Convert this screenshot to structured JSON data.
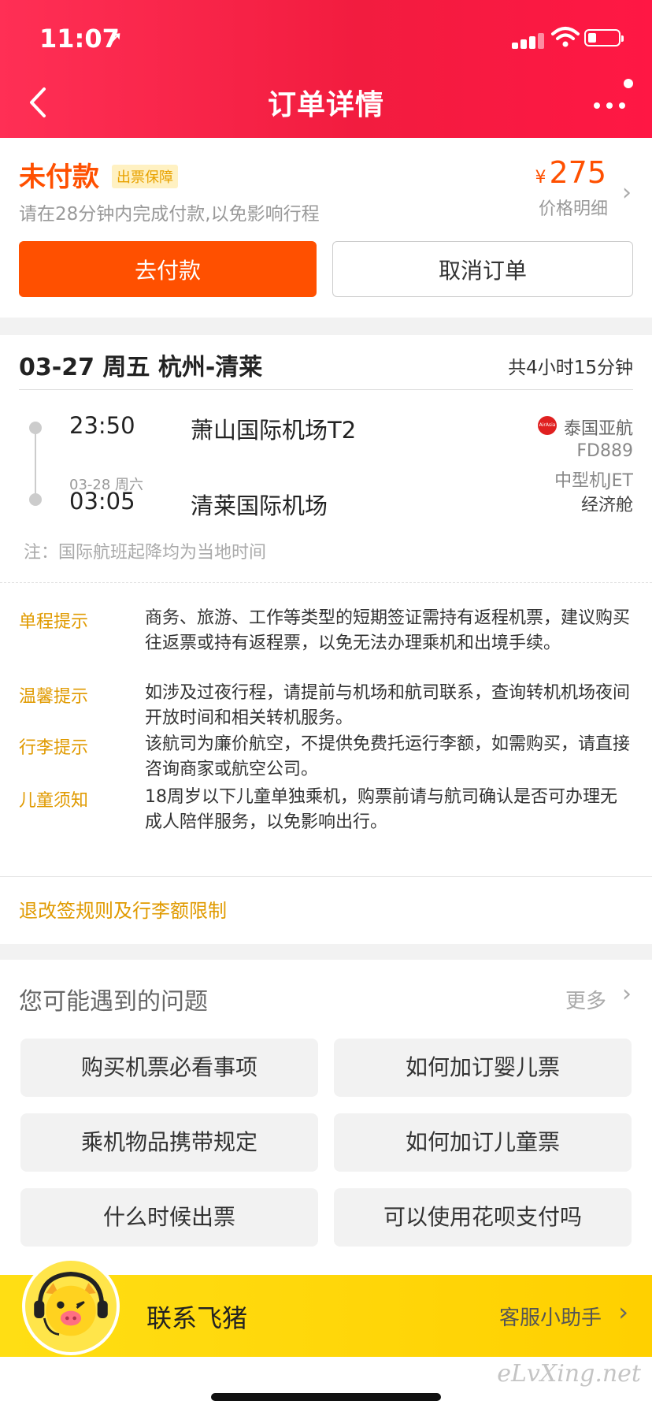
{
  "status_bar": {
    "time": "11:07",
    "location_glyph": "➚"
  },
  "header": {
    "title": "订单详情",
    "back_icon": "chevron-left-icon",
    "more_icon": "more-dots-icon"
  },
  "order_status": {
    "title": "未付款",
    "badge": "出票保障",
    "hint": "请在28分钟内完成付款,以免影响行程",
    "currency": "¥",
    "price": "275",
    "price_detail_label": "价格明细",
    "pay_label": "去付款",
    "cancel_label": "取消订单"
  },
  "flight": {
    "route_title": "03-27 周五 杭州-清莱",
    "duration": "共4小时15分钟",
    "departure_time": "23:50",
    "departure_airport": "萧山国际机场T2",
    "arrival_date": "03-28 周六",
    "arrival_time": "03:05",
    "arrival_airport": "清莱国际机场",
    "airline_logo_text": "AirAsia",
    "airline": "泰国亚航",
    "flight_no": "FD889",
    "aircraft": "中型机JET",
    "cabin": "经济舱",
    "note": "注：国际航班起降均为当地时间"
  },
  "tips": [
    {
      "label": "单程提示",
      "text": "商务、旅游、工作等类型的短期签证需持有返程机票，建议购买往返票或持有返程票，以免无法办理乘机和出境手续。"
    },
    {
      "label": "温馨提示",
      "text": "如涉及过夜行程，请提前与机场和航司联系，查询转机机场夜间开放时间和相关转机服务。"
    },
    {
      "label": "行李提示",
      "text": "该航司为廉价航空，不提供免费托运行李额，如需购买，请直接咨询商家或航空公司。"
    },
    {
      "label": "儿童须知",
      "text": "18周岁以下儿童单独乘机，购票前请与航司确认是否可办理无成人陪伴服务，以免影响出行。"
    }
  ],
  "rules_link": "退改签规则及行李额限制",
  "faq": {
    "title": "您可能遇到的问题",
    "more_label": "更多",
    "items": [
      "购买机票必看事项",
      "如何加订婴儿票",
      "乘机物品携带规定",
      "如何加订儿童票",
      "什么时候出票",
      "可以使用花呗支付吗"
    ]
  },
  "contact": {
    "label": "联系飞猪",
    "assistant_label": "客服小助手"
  },
  "watermark": "eLvXing.net",
  "colors": {
    "header_red": "#f21c3f",
    "accent_orange": "#ff5000",
    "tip_gold": "#e09a00",
    "contact_yellow": "#ffd000"
  }
}
